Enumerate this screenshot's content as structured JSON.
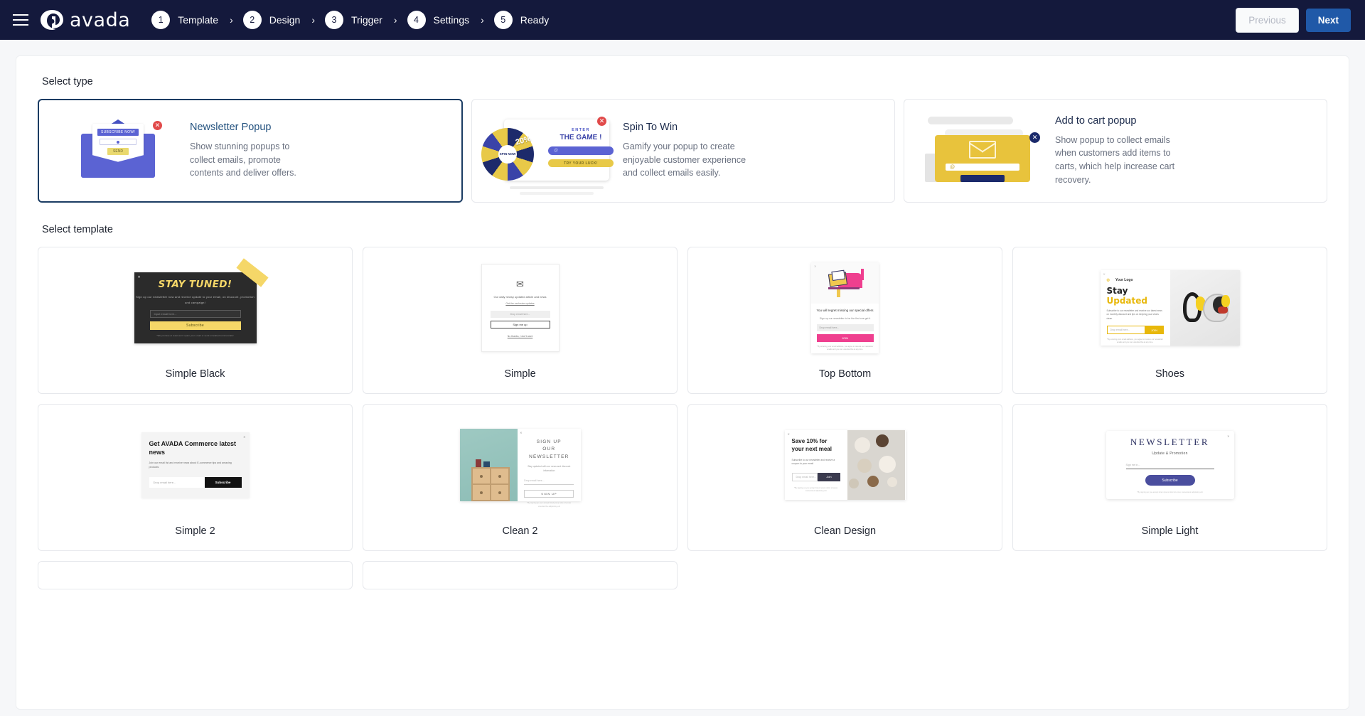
{
  "header": {
    "brand": "avada",
    "menu_icon": "hamburger-icon",
    "steps": [
      {
        "num": "1",
        "label": "Template"
      },
      {
        "num": "2",
        "label": "Design"
      },
      {
        "num": "3",
        "label": "Trigger"
      },
      {
        "num": "4",
        "label": "Settings"
      },
      {
        "num": "5",
        "label": "Ready"
      }
    ],
    "separator": "›",
    "previous_label": "Previous",
    "next_label": "Next",
    "bg_color": "#14193c",
    "next_color": "#2059a8"
  },
  "sections": {
    "select_type_title": "Select type",
    "select_template_title": "Select template"
  },
  "types": [
    {
      "name": "Newsletter Popup",
      "desc": "Show stunning popups to collect emails, promote contents and deliver offers.",
      "selected": true,
      "thumb": {
        "badge": "SUBSCRIBE NOW!",
        "button": "SEND"
      }
    },
    {
      "name": "Spin To Win",
      "desc": "Gamify your popup to create enjoyable customer experience and collect emails easily.",
      "selected": false,
      "thumb": {
        "enter": "ENTER",
        "game": "THE GAME !",
        "field": "@",
        "button": "TRY YOUR LUCK!",
        "wheel_label": "20%",
        "hub": "SPIN NOW"
      }
    },
    {
      "name": "Add to cart popup",
      "desc": "Show popup to collect emails when customers add items to carts, which help increase cart recovery.",
      "selected": false,
      "thumb": {
        "field": "@"
      }
    }
  ],
  "templates": [
    {
      "name": "Simple Black",
      "preview": {
        "heading": "STAY TUNED!",
        "sub": "Sign up our newsletter now and receive update to your email, on discount, promotion and campaign!",
        "field": "Input email here...",
        "button": "Subscribe",
        "note": "*We promise at least won't spam your email or send unrelated commercials!"
      }
    },
    {
      "name": "Simple",
      "preview": {
        "line": "Our daily newsy updated article and news",
        "link": "Get the exclusive updates",
        "field": "Drop email here...",
        "button": "Sign me up",
        "decline": "No thanks, I don't want"
      }
    },
    {
      "name": "Top Bottom",
      "preview": {
        "heading": "You will regret missing our special offers",
        "sub": "Sign up our newsletter to be the first one get it",
        "field": "Drop email here...",
        "button": "JOIN",
        "note": "* By entering your email address, you agree to receive our newsletter emails and you can unsubscribe at any time."
      }
    },
    {
      "name": "Shoes",
      "preview": {
        "logo": "Your Logo",
        "heading_dark": "Stay ",
        "heading_accent": "Updated",
        "sub": "Subscribe to our newsletter and receive our latest news on monthly discount and tips on keeping your shoes clean.",
        "field": "Drop email here...",
        "button": "JOIN",
        "note": "*By entering your email address, you agree to receive our newsletter emails and you can unsubscribe at any time."
      }
    },
    {
      "name": "Simple 2",
      "preview": {
        "heading": "Get AVADA Commerce latest news",
        "sub": "Join our email list and receive news about E-commerce tips and amazing products",
        "field": "Drop email here...",
        "button": "Subscribe"
      }
    },
    {
      "name": "Clean 2",
      "preview": {
        "heading_line1": "SIGN UP",
        "heading_line2": "OUR NEWSLETTER",
        "sub": "Stay updated with our news and discount information",
        "field": "Drop email here...",
        "button": "SIGN UP",
        "note": "*By signing up your accept listed group rules of email, unsubscribe adipisicing elit"
      }
    },
    {
      "name": "Clean Design",
      "preview": {
        "heading": "Save 10% for your next meal",
        "sub": "Subscribe to our newsletter and receive a coupon to your email",
        "field": "Drop email here...",
        "button": "Join",
        "note": "*By signing up you accept lorem ipsum dolor sit amet, consectetur adipiscing elit"
      }
    },
    {
      "name": "Simple Light",
      "preview": {
        "heading": "NEWSLETTER",
        "sub": "Update & Promotion",
        "field": "Sign me in...",
        "button": "Subscribe",
        "note": "*By signing up you accept lorem ipsum dolor sit amet, consectetur adipiscing elit"
      }
    }
  ]
}
